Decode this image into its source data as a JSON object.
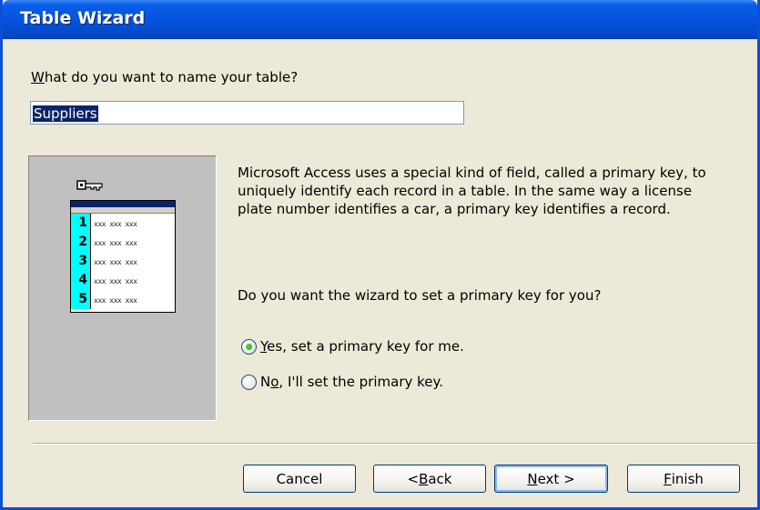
{
  "window": {
    "title": "Table Wizard"
  },
  "name_prompt": {
    "before": "",
    "accel": "W",
    "after": "hat do you want to name your table?"
  },
  "table_name": "Suppliers",
  "illustration": {
    "row_numbers": [
      "1",
      "2",
      "3",
      "4",
      "5"
    ],
    "cell_text": "xxx xxx xxx"
  },
  "description": "Microsoft Access uses a special kind of field, called a primary key, to uniquely identify each record in a table. In the same way a license plate number identifies a car, a primary key identifies a record.",
  "question": "Do you want the wizard to set a primary key for you?",
  "options": [
    {
      "accel": "Y",
      "rest": "es, set a primary key for me.",
      "checked": true
    },
    {
      "pre": "N",
      "accel": "o",
      "rest": ", I'll set the primary key.",
      "checked": false
    }
  ],
  "buttons": {
    "cancel": "Cancel",
    "back_pre": "< ",
    "back_accel": "B",
    "back_rest": "ack",
    "next_accel": "N",
    "next_rest": "ext >",
    "finish_accel": "F",
    "finish_rest": "inish"
  },
  "colors": {
    "title_bar": "#0553dd",
    "dialog_bg": "#ece9d8",
    "highlight": "#0a246a",
    "row_number_bg": "#00ffff"
  }
}
